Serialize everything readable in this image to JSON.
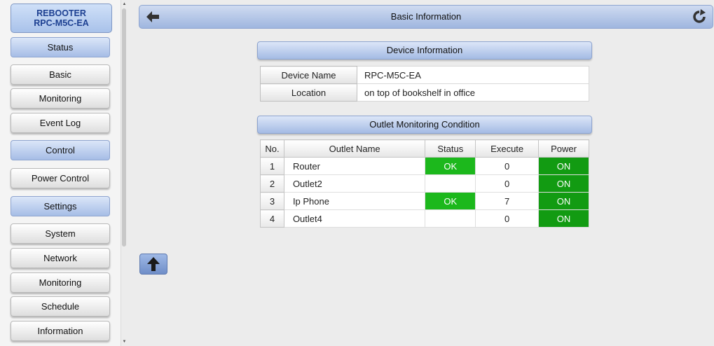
{
  "brand": {
    "line1": "REBOOTER",
    "line2": "RPC-M5C-EA"
  },
  "sidebar": {
    "items": [
      {
        "label": "Status",
        "kind": "head"
      },
      {
        "label": "Basic",
        "kind": "sub"
      },
      {
        "label": "Monitoring",
        "kind": "sub"
      },
      {
        "label": "Event Log",
        "kind": "sub"
      },
      {
        "label": "Control",
        "kind": "head"
      },
      {
        "label": "Power Control",
        "kind": "sub"
      },
      {
        "label": "Settings",
        "kind": "head"
      },
      {
        "label": "System",
        "kind": "sub"
      },
      {
        "label": "Network",
        "kind": "sub"
      },
      {
        "label": "Monitoring",
        "kind": "sub"
      },
      {
        "label": "Schedule",
        "kind": "sub"
      },
      {
        "label": "Information",
        "kind": "sub"
      }
    ]
  },
  "topbar": {
    "title": "Basic Information",
    "back_icon": "arrow-left-icon",
    "refresh_icon": "refresh-icon"
  },
  "device_info": {
    "heading": "Device Information",
    "rows": [
      {
        "label": "Device Name",
        "value": "RPC-M5C-EA"
      },
      {
        "label": "Location",
        "value": "on top of bookshelf in office"
      }
    ]
  },
  "outlets": {
    "heading": "Outlet Monitoring Condition",
    "columns": [
      "No.",
      "Outlet Name",
      "Status",
      "Execute",
      "Power"
    ],
    "rows": [
      {
        "no": "1",
        "name": "Router",
        "status": "OK",
        "execute": "0",
        "power": "ON"
      },
      {
        "no": "2",
        "name": "Outlet2",
        "status": "",
        "execute": "0",
        "power": "ON"
      },
      {
        "no": "3",
        "name": "Ip Phone",
        "status": "OK",
        "execute": "7",
        "power": "ON"
      },
      {
        "no": "4",
        "name": "Outlet4",
        "status": "",
        "execute": "0",
        "power": "ON"
      }
    ]
  },
  "colors": {
    "status_ok": "#1cb81c",
    "power_on": "#129b12",
    "accent": "#a4bbe4"
  }
}
